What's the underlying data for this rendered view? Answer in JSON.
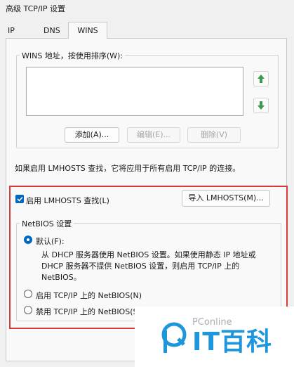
{
  "window": {
    "title": "高级 TCP/IP 设置"
  },
  "tabs": [
    {
      "label": "IP 设置"
    },
    {
      "label": "DNS"
    },
    {
      "label": "WINS",
      "selected": true
    }
  ],
  "wins": {
    "group_label": "WINS 地址，按使用排序(W):",
    "add_label": "添加(A)...",
    "edit_label": "编辑(E)...",
    "remove_label": "删除(V)",
    "info_text": "如果启用 LMHOSTS 查找，它将应用于所有启用 TCP/IP 的连接。"
  },
  "lmhosts": {
    "enable_label": "启用 LMHOSTS 查找(L)",
    "enable_checked": true,
    "import_label": "导入 LMHOSTS(M)..."
  },
  "netbios": {
    "group_label": "NetBIOS 设置",
    "options": [
      {
        "label": "默认(F):",
        "checked": true
      },
      {
        "label": "启用 TCP/IP 上的 NetBIOS(N)",
        "checked": false
      },
      {
        "label": "禁用 TCP/IP 上的 NetBIOS(S)",
        "checked": false
      }
    ],
    "default_desc_1": "从 DHCP 服务器使用 NetBIOS 设置。如果使用静态 IP 地址或",
    "default_desc_2": "DHCP 服务器不提供 NetBIOS 设置，则启用 TCP/IP 上的",
    "default_desc_3": "NetBIOS。"
  },
  "watermark": {
    "brand": "PConline",
    "cn_text": "IT百科"
  },
  "colors": {
    "accent": "#0067c0",
    "highlight": "#d93a3a",
    "arrow": "#3c9a4f",
    "logo": "#1e96dc"
  }
}
